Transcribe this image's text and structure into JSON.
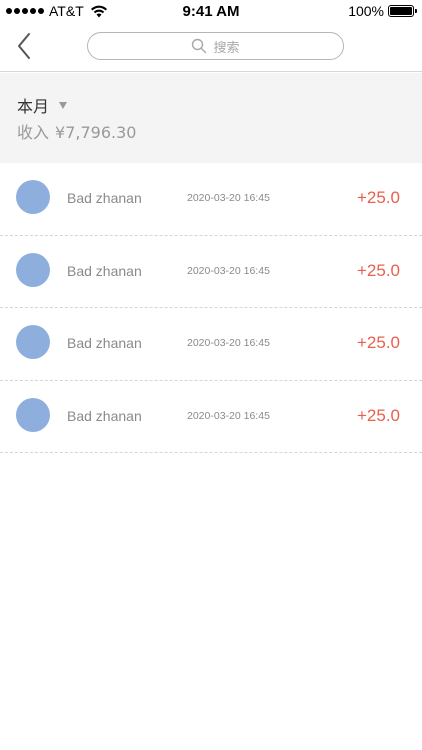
{
  "status_bar": {
    "carrier": "AT&T",
    "time": "9:41 AM",
    "battery_percent": "100%"
  },
  "nav": {
    "back_icon": "chevron-left-icon",
    "search_placeholder": "搜索"
  },
  "summary": {
    "period_label": "本月",
    "income_label": "收入",
    "income_amount": "¥7,796.30"
  },
  "transactions": [
    {
      "name": "Bad zhanan",
      "time": "2020-03-20 16:45",
      "amount": "+25.0"
    },
    {
      "name": "Bad zhanan",
      "time": "2020-03-20 16:45",
      "amount": "+25.0"
    },
    {
      "name": "Bad zhanan",
      "time": "2020-03-20 16:45",
      "amount": "+25.0"
    },
    {
      "name": "Bad zhanan",
      "time": "2020-03-20 16:45",
      "amount": "+25.0"
    }
  ],
  "colors": {
    "amount": "#e8604c",
    "avatar": "#8eafdd",
    "summary_bg": "#f4f4f4"
  }
}
